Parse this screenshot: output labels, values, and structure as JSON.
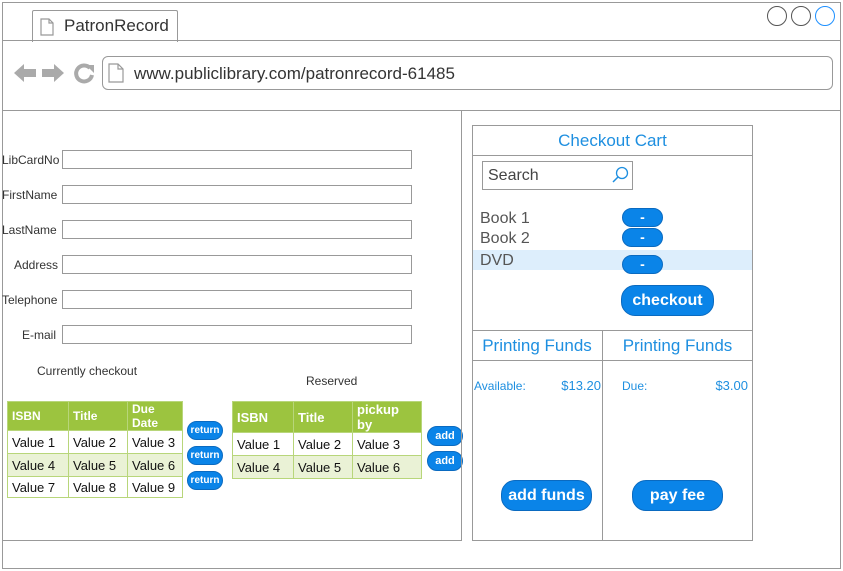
{
  "browser": {
    "tab_title": "PatronRecord",
    "url": "www.publiclibrary.com/patronrecord-61485"
  },
  "form": {
    "fields": [
      {
        "label": "LibCardNo",
        "value": ""
      },
      {
        "label": "FirstName",
        "value": ""
      },
      {
        "label": "LastName",
        "value": ""
      },
      {
        "label": "Address",
        "value": ""
      },
      {
        "label": "Telephone",
        "value": ""
      },
      {
        "label": "E-mail",
        "value": ""
      }
    ]
  },
  "checkout_table": {
    "title": "Currently checkout",
    "headers": [
      "ISBN",
      "Title",
      "Due Date"
    ],
    "rows": [
      [
        "Value 1",
        "Value 2",
        "Value 3"
      ],
      [
        "Value 4",
        "Value 5",
        "Value 6"
      ],
      [
        "Value 7",
        "Value 8",
        "Value 9"
      ]
    ],
    "action_label": "return"
  },
  "reserved_table": {
    "title": "Reserved",
    "headers": [
      "ISBN",
      "Title",
      "pickup by"
    ],
    "rows": [
      [
        "Value 1",
        "Value 2",
        "Value 3"
      ],
      [
        "Value 4",
        "Value 5",
        "Value 6"
      ]
    ],
    "action_label": "add"
  },
  "cart": {
    "title": "Checkout Cart",
    "search_placeholder": "Search",
    "items": [
      "Book 1",
      "Book 2",
      "DVD"
    ],
    "remove_label": "-",
    "checkout_label": "checkout",
    "selected_index": 2
  },
  "funds": {
    "left": {
      "title": "Printing Funds",
      "label": "Available:",
      "amount": "$13.20",
      "button": "add funds"
    },
    "right": {
      "title": "Printing Funds",
      "label": "Due:",
      "amount": "$3.00",
      "button": "pay fee"
    }
  },
  "colors": {
    "accent": "#0A84E8",
    "table_header": "#9CC43F",
    "selection": "#DDEEFC"
  }
}
